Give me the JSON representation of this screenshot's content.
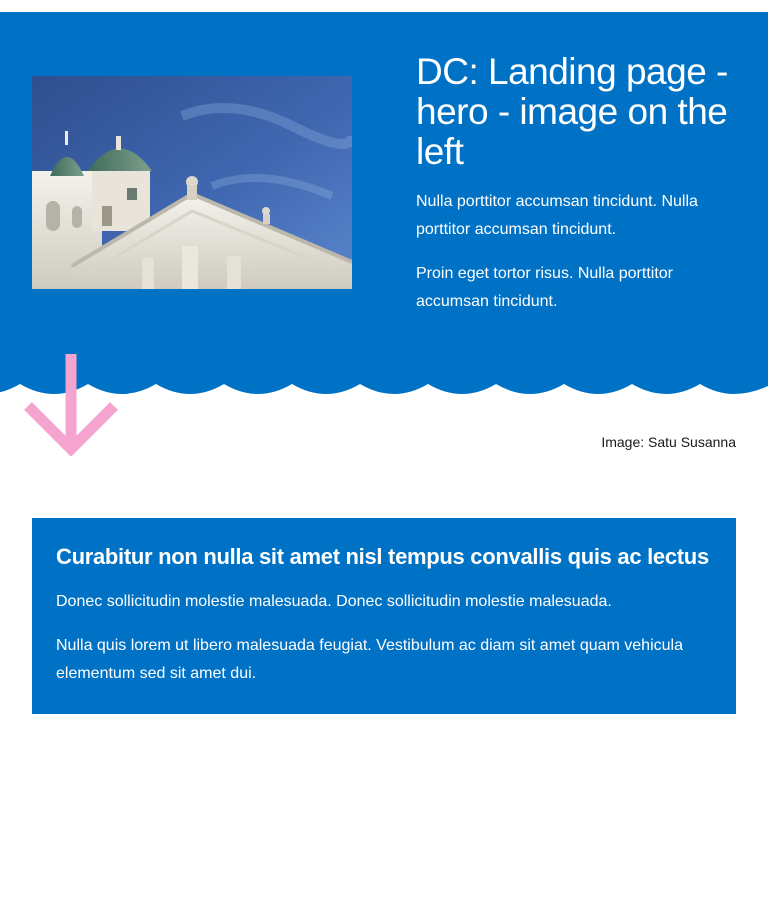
{
  "hero": {
    "title": "DC: Landing page - hero - image on the left",
    "paragraph1": "Nulla porttitor accumsan tincidunt. Nulla porttitor accumsan tincidunt.",
    "paragraph2": "Proin eget tortor risus. Nulla porttitor accumsan tincidunt.",
    "background_color": "#0072c6",
    "image_subject": "cathedral-photo"
  },
  "caption": {
    "text": "Image: Satu Susanna"
  },
  "decoration": {
    "arrow_icon": "arrow-down-icon",
    "arrow_color": "#f5a3cf"
  },
  "card": {
    "title": "Curabitur non nulla sit amet nisl tempus convallis quis ac lectus",
    "paragraph1": "Donec sollicitudin molestie malesuada. Donec sollicitudin molestie malesuada.",
    "paragraph2": "Nulla quis lorem ut libero malesuada feugiat. Vestibulum ac diam sit amet quam vehicula elementum sed sit amet dui.",
    "background_color": "#0072c6"
  }
}
